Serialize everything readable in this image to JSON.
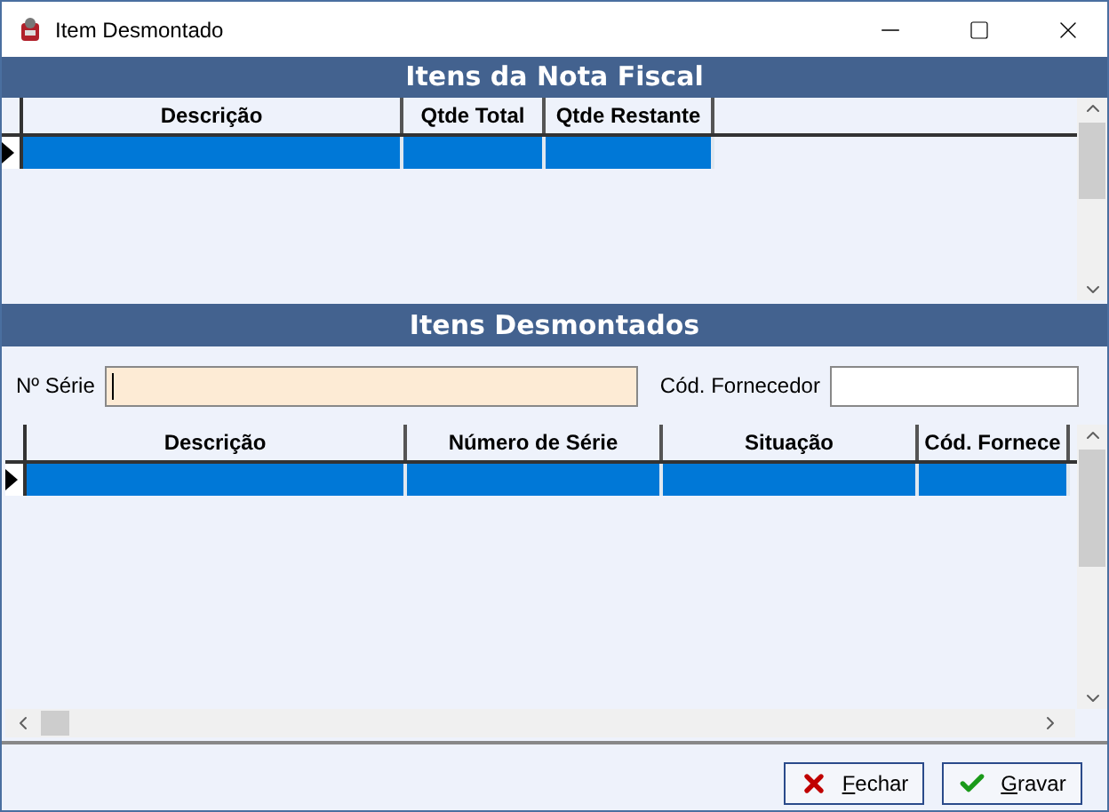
{
  "window": {
    "title": "Item Desmontado"
  },
  "invoice_items": {
    "title": "Itens da Nota Fiscal",
    "columns": [
      "Descrição",
      "Qtde Total",
      "Qtde Restante"
    ],
    "rows": [
      {
        "selected": true
      }
    ]
  },
  "disassembled_items": {
    "title": "Itens Desmontados",
    "serial_label": "Nº Série",
    "supplier_label": "Cód. Fornecedor",
    "columns": [
      "Descrição",
      "Número de Série",
      "Situação",
      "Cód. Fornece"
    ],
    "rows": [
      {
        "selected": true
      }
    ]
  },
  "buttons": [
    {
      "kind": "close",
      "label": "Fechar"
    },
    {
      "kind": "save",
      "label": "Gravar"
    }
  ]
}
